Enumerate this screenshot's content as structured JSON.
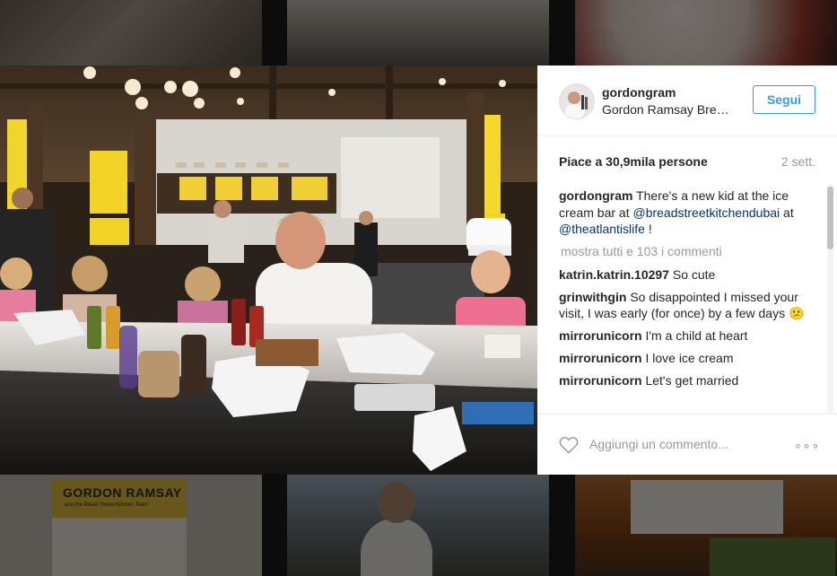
{
  "post": {
    "username": "gordongram",
    "location": "Gordon Ramsay Bre…",
    "follow_label": "Segui",
    "likes": "Piace a 30,9mila persone",
    "date": "2 sett.",
    "caption": {
      "user": "gordongram",
      "text_before": "There's a new kid at the ice cream bar at ",
      "mention1": "@breadstreetkitchendubai",
      "text_mid": " at ",
      "mention2": "@theatlantislife",
      "text_after": " !"
    },
    "view_all": "mostra tutti e 103 i commenti",
    "comments": [
      {
        "user": "katrin.katrin.10297",
        "text": "So cute"
      },
      {
        "user": "grinwithgin",
        "text": "So disappointed I missed your visit, I was early (for once) by a few days 😕"
      },
      {
        "user": "mirrorunicorn",
        "text": "I'm a child at heart"
      },
      {
        "user": "mirrorunicorn",
        "text": "I love ice cream"
      },
      {
        "user": "mirrorunicorn",
        "text": "Let's get married"
      }
    ],
    "add_comment_placeholder": "Aggiungi un commento...",
    "more_options": "∘∘∘"
  },
  "background": {
    "book_title": "GORDON RAMSAY",
    "book_subtitle": "and the Bread Street Kitchen Team"
  },
  "colors": {
    "accent": "#3897f0",
    "mention": "#003569",
    "muted": "#999999"
  }
}
